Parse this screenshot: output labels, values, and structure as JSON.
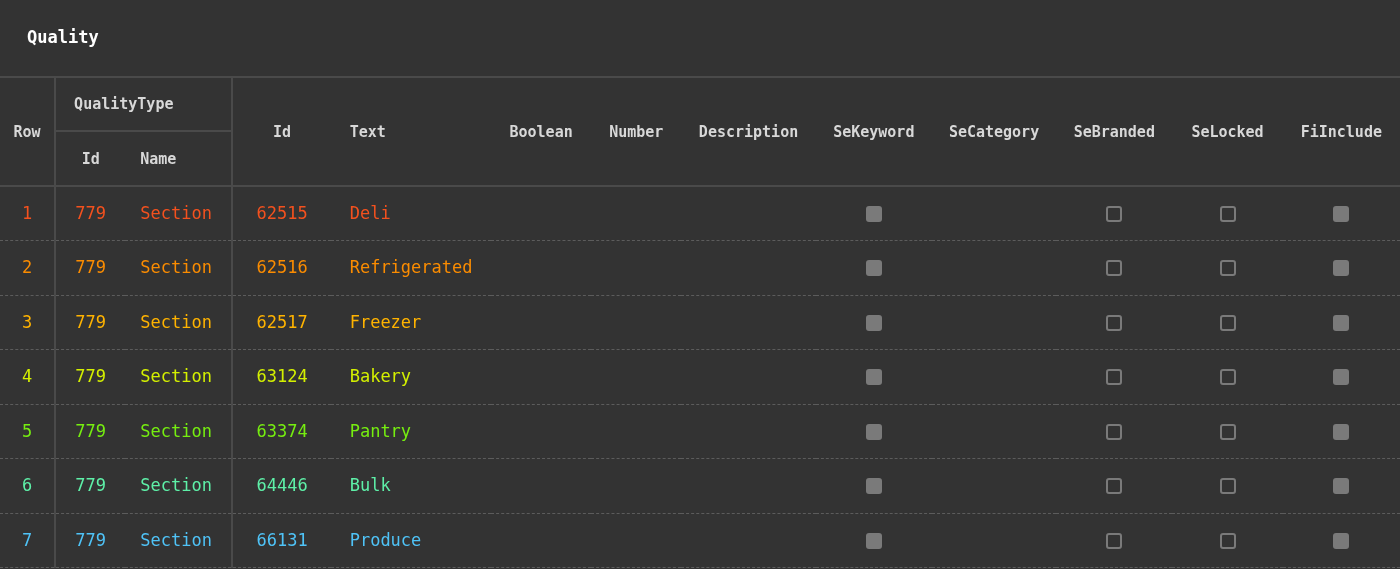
{
  "title": "Quality",
  "header": {
    "row": "Row",
    "group": "QualityType",
    "group_columns": [
      "Id",
      "Name"
    ],
    "columns": [
      "Id",
      "Text",
      "Boolean",
      "Number",
      "Description",
      "SeKeyword",
      "SeCategory",
      "SeBranded",
      "SeLocked",
      "FiInclude"
    ]
  },
  "rows": [
    {
      "color": "#f4511e",
      "row": "1",
      "qt_id": "779",
      "qt_name": "Section",
      "id": "62515",
      "text": "Deli",
      "se_keyword": true,
      "se_branded": false,
      "se_locked": false,
      "fi_include": true
    },
    {
      "color": "#fb8c00",
      "row": "2",
      "qt_id": "779",
      "qt_name": "Section",
      "id": "62516",
      "text": "Refrigerated",
      "se_keyword": true,
      "se_branded": false,
      "se_locked": false,
      "fi_include": true
    },
    {
      "color": "#ffb300",
      "row": "3",
      "qt_id": "779",
      "qt_name": "Section",
      "id": "62517",
      "text": "Freezer",
      "se_keyword": true,
      "se_branded": false,
      "se_locked": false,
      "fi_include": true
    },
    {
      "color": "#d4f000",
      "row": "4",
      "qt_id": "779",
      "qt_name": "Section",
      "id": "63124",
      "text": "Bakery",
      "se_keyword": true,
      "se_branded": false,
      "se_locked": false,
      "fi_include": true
    },
    {
      "color": "#76ee10",
      "row": "5",
      "qt_id": "779",
      "qt_name": "Section",
      "id": "63374",
      "text": "Pantry",
      "se_keyword": true,
      "se_branded": false,
      "se_locked": false,
      "fi_include": true
    },
    {
      "color": "#5ef0a8",
      "row": "6",
      "qt_id": "779",
      "qt_name": "Section",
      "id": "64446",
      "text": "Bulk",
      "se_keyword": true,
      "se_branded": false,
      "se_locked": false,
      "fi_include": true
    },
    {
      "color": "#4fc3f7",
      "row": "7",
      "qt_id": "779",
      "qt_name": "Section",
      "id": "66131",
      "text": "Produce",
      "se_keyword": true,
      "se_branded": false,
      "se_locked": false,
      "fi_include": true
    }
  ]
}
